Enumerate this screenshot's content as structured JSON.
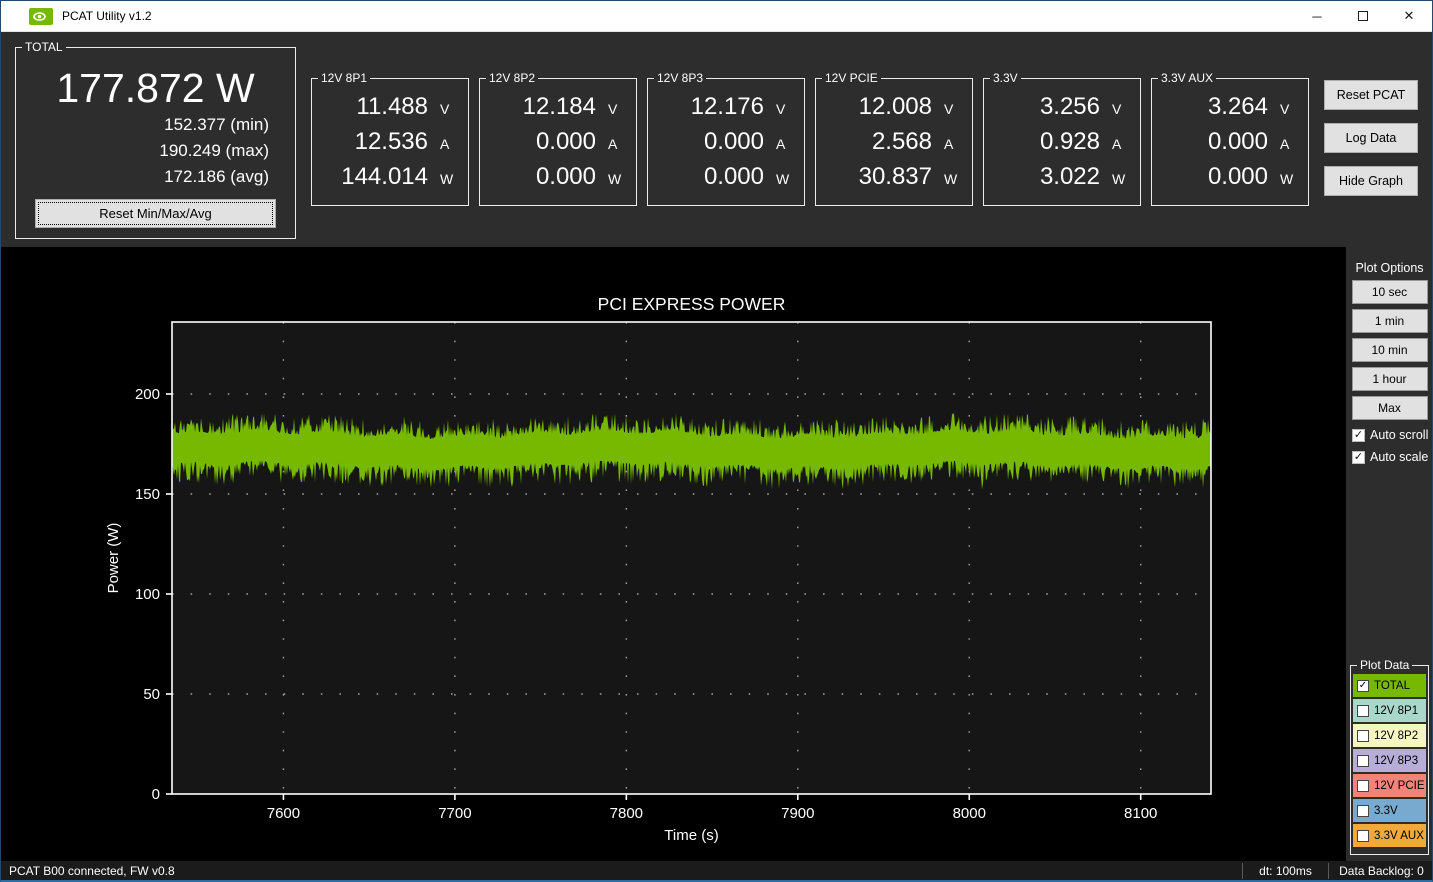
{
  "window": {
    "title": "PCAT Utility v1.2",
    "brand_color": "#76b900",
    "controls": {
      "minimize": "─",
      "close": "✕"
    }
  },
  "total": {
    "label": "TOTAL",
    "value": "177.872 W",
    "min": "152.377 (min)",
    "max": "190.249 (max)",
    "avg": "172.186 (avg)",
    "reset_button": "Reset Min/Max/Avg"
  },
  "rails": [
    {
      "label": "12V 8P1",
      "rows": [
        {
          "value": "11.488",
          "unit": "V"
        },
        {
          "value": "12.536",
          "unit": "A"
        },
        {
          "value": "144.014",
          "unit": "W"
        }
      ]
    },
    {
      "label": "12V 8P2",
      "rows": [
        {
          "value": "12.184",
          "unit": "V"
        },
        {
          "value": "0.000",
          "unit": "A"
        },
        {
          "value": "0.000",
          "unit": "W"
        }
      ]
    },
    {
      "label": "12V 8P3",
      "rows": [
        {
          "value": "12.176",
          "unit": "V"
        },
        {
          "value": "0.000",
          "unit": "A"
        },
        {
          "value": "0.000",
          "unit": "W"
        }
      ]
    },
    {
      "label": "12V PCIE",
      "rows": [
        {
          "value": "12.008",
          "unit": "V"
        },
        {
          "value": "2.568",
          "unit": "A"
        },
        {
          "value": "30.837",
          "unit": "W"
        }
      ]
    },
    {
      "label": "3.3V",
      "rows": [
        {
          "value": "3.256",
          "unit": "V"
        },
        {
          "value": "0.928",
          "unit": "A"
        },
        {
          "value": "3.022",
          "unit": "W"
        }
      ]
    },
    {
      "label": "3.3V AUX",
      "rows": [
        {
          "value": "3.264",
          "unit": "V"
        },
        {
          "value": "0.000",
          "unit": "A"
        },
        {
          "value": "0.000",
          "unit": "W"
        }
      ]
    }
  ],
  "actions": [
    "Reset PCAT",
    "Log Data",
    "Hide Graph"
  ],
  "plot_options": {
    "title": "Plot Options",
    "buttons": [
      "10 sec",
      "1 min",
      "10 min",
      "1 hour",
      "Max"
    ],
    "checkboxes": [
      {
        "label": "Auto scroll",
        "checked": true
      },
      {
        "label": "Auto scale",
        "checked": true
      }
    ]
  },
  "plot_data": {
    "title": "Plot Data",
    "series": [
      {
        "label": "TOTAL",
        "color": "#76b900",
        "checked": true
      },
      {
        "label": "12V 8P1",
        "color": "#a9d7c9",
        "checked": false
      },
      {
        "label": "12V 8P2",
        "color": "#f6f6c3",
        "checked": false
      },
      {
        "label": "12V 8P3",
        "color": "#b6aed7",
        "checked": false
      },
      {
        "label": "12V PCIE",
        "color": "#f18478",
        "checked": false
      },
      {
        "label": "3.3V",
        "color": "#78aacf",
        "checked": false
      },
      {
        "label": "3.3V AUX",
        "color": "#f2a93b",
        "checked": false
      }
    ]
  },
  "status_bar": {
    "left": "PCAT B00 connected, FW v0.8",
    "dt": "dt: 100ms",
    "backlog": "Data Backlog: 0"
  },
  "chart_data": {
    "type": "line",
    "title": "PCI EXPRESS POWER",
    "xlabel": "Time (s)",
    "ylabel": "Power (W)",
    "xlim": [
      7535,
      8141
    ],
    "ylim": [
      0,
      236
    ],
    "xticks": [
      7600,
      7700,
      7800,
      7900,
      8000,
      8100
    ],
    "yticks": [
      0,
      50,
      100,
      150,
      200
    ],
    "grid": "dotted",
    "series": [
      {
        "name": "TOTAL",
        "color": "#76b900",
        "stats": {
          "current": 177.872,
          "min": 152.377,
          "max": 190.249,
          "avg": 172.186
        },
        "band_core": [
          164,
          180
        ],
        "band_extent": [
          152.4,
          190.2
        ],
        "noise_seed": 7
      }
    ]
  }
}
